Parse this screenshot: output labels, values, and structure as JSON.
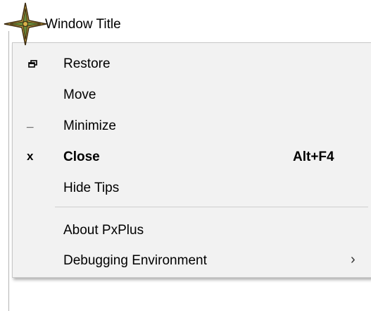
{
  "window": {
    "title": "Window Title",
    "icon": "compass-star-icon"
  },
  "menu": {
    "items": [
      {
        "label": "Restore",
        "icon": "restore-icon",
        "glyph": ""
      },
      {
        "label": "Move",
        "icon": "",
        "glyph": ""
      },
      {
        "label": "Minimize",
        "icon": "minimize-icon",
        "glyph": "_"
      },
      {
        "label": "Close",
        "icon": "close-icon",
        "glyph": "x",
        "shortcut": "Alt+F4",
        "bold": true
      },
      {
        "label": "Hide Tips",
        "icon": "",
        "glyph": ""
      },
      {
        "label": "About PxPlus",
        "icon": "",
        "glyph": ""
      },
      {
        "label": "Debugging Environment",
        "icon": "",
        "glyph": "",
        "submenu_glyph": "›"
      }
    ]
  },
  "colors": {
    "menu_background": "#f2f2f2",
    "menu_border": "#c8c8c8",
    "icon_gold": "#d8b24a",
    "icon_dark": "#3a2a10",
    "icon_green": "#6a8a3a"
  }
}
